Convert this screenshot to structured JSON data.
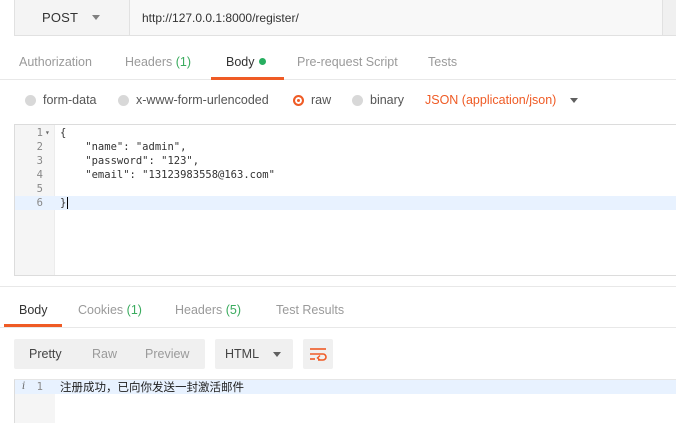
{
  "request": {
    "method": "POST",
    "url": "http://127.0.0.1:8000/register/"
  },
  "request_tabs": {
    "authorization": "Authorization",
    "headers": "Headers",
    "headers_count": "(1)",
    "body": "Body",
    "prerequest": "Pre-request Script",
    "tests": "Tests"
  },
  "body_options": {
    "form_data": "form-data",
    "urlencoded": "x-www-form-urlencoded",
    "raw": "raw",
    "binary": "binary",
    "selected": "raw",
    "format": "JSON (application/json)"
  },
  "editor": {
    "line_numbers": [
      "1",
      "2",
      "3",
      "4",
      "5",
      "6"
    ],
    "lines": [
      "{",
      "    \"name\": \"admin\",",
      "    \"password\": \"123\",",
      "    \"email\": \"13123983558@163.com\"",
      "",
      "}"
    ]
  },
  "response_tabs": {
    "body": "Body",
    "cookies": "Cookies",
    "cookies_count": "(1)",
    "headers": "Headers",
    "headers_count": "(5)",
    "test_results": "Test Results"
  },
  "response_view": {
    "pretty": "Pretty",
    "raw": "Raw",
    "preview": "Preview",
    "language": "HTML",
    "wrap_icon": "wrap-lines-icon"
  },
  "response_body": {
    "line_number": "1",
    "info_glyph": "i",
    "text": "注册成功，已向你发送一封激活邮件"
  },
  "colors": {
    "accent": "#ef5b25",
    "count_green": "#3aab5e",
    "status_dot": "#27ae60"
  }
}
